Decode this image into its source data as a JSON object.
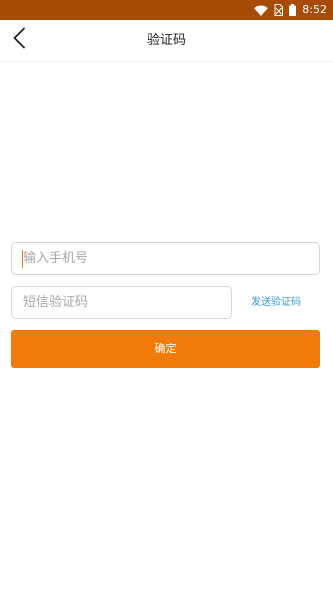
{
  "status_bar": {
    "time": "8:52",
    "background": "#a74b06",
    "icons": [
      "wifi-icon",
      "sim-no-signal-icon",
      "battery-icon"
    ]
  },
  "nav": {
    "title": "验证码",
    "back_icon": "chevron-left-icon"
  },
  "form": {
    "phone_placeholder": "输入手机号",
    "phone_value": "",
    "code_placeholder": "短信验证码",
    "code_value": "",
    "send_code_label": "发送验证码",
    "confirm_label": "确定"
  },
  "colors": {
    "accent": "#f17a08",
    "link": "#3a9bd0",
    "caret": "#e9770b"
  }
}
